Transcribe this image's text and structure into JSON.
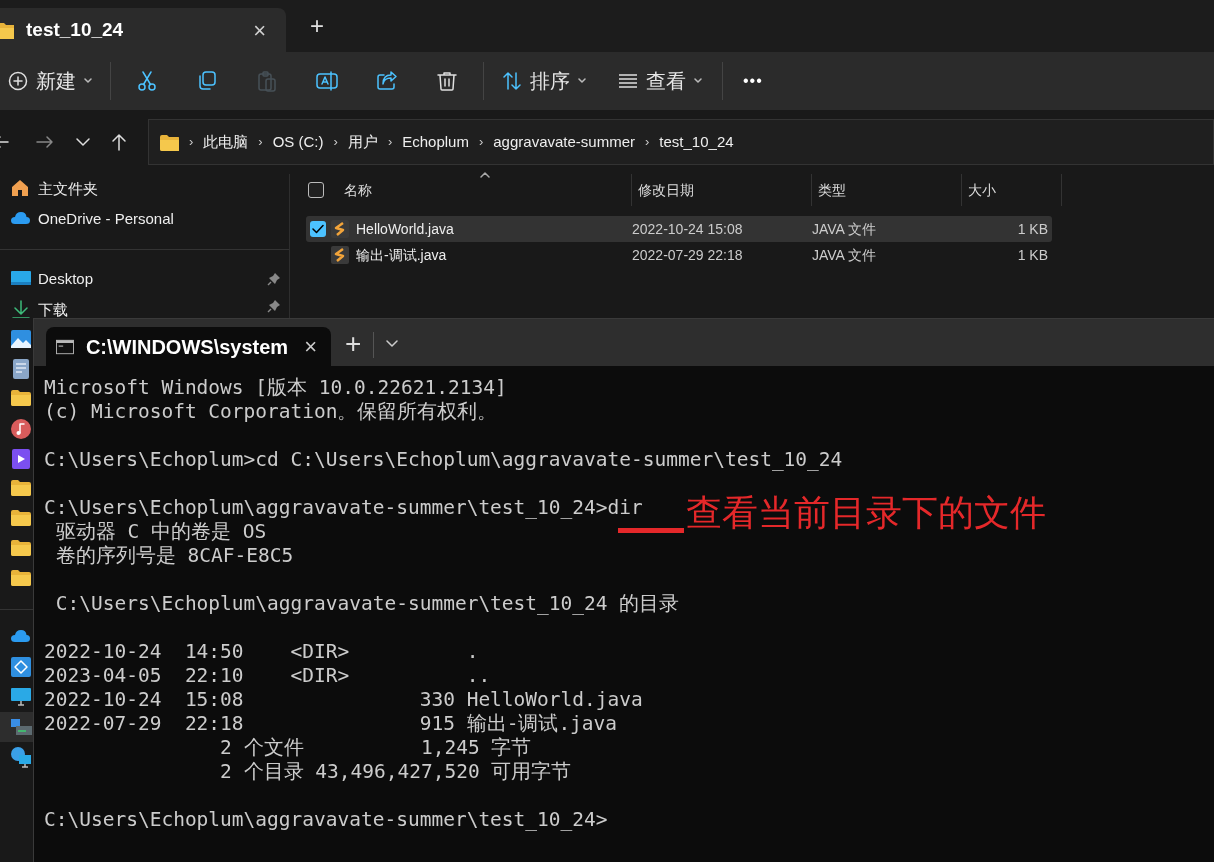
{
  "explorer": {
    "tab": {
      "title": "test_10_24",
      "close": "×",
      "new_tab": "+"
    },
    "toolbar": {
      "new": "新建",
      "actions": [
        {
          "kind": "cut",
          "disabled": false
        },
        {
          "kind": "copy",
          "disabled": false
        },
        {
          "kind": "paste",
          "disabled": true
        },
        {
          "kind": "rename",
          "disabled": false
        },
        {
          "kind": "share",
          "disabled": false
        },
        {
          "kind": "delete",
          "disabled": false
        }
      ],
      "sort": "排序",
      "view": "查看",
      "more": "•••"
    },
    "breadcrumb_separator": "›",
    "breadcrumbs": [
      "此电脑",
      "OS (C:)",
      "用户",
      "Echoplum",
      "aggravavate-summer",
      "test_10_24"
    ],
    "sidebar": {
      "groups": [
        [
          {
            "kind": "home",
            "label": "主文件夹",
            "pinned": false,
            "selected": false
          },
          {
            "kind": "cloud",
            "label": "OneDrive - Personal",
            "pinned": false,
            "selected": false
          }
        ],
        [
          {
            "kind": "desktop",
            "label": "Desktop",
            "pinned": true,
            "selected": false
          },
          {
            "kind": "download",
            "label": "下载",
            "pinned": true,
            "selected": false
          },
          {
            "kind": "picture",
            "selected": false
          },
          {
            "kind": "document",
            "selected": false
          },
          {
            "kind": "folder",
            "selected": false
          },
          {
            "kind": "music",
            "selected": false
          },
          {
            "kind": "video",
            "selected": false
          },
          {
            "kind": "folder",
            "selected": false
          },
          {
            "kind": "folder",
            "selected": false
          },
          {
            "kind": "folder",
            "selected": false
          },
          {
            "kind": "folder",
            "selected": false
          }
        ],
        [
          {
            "kind": "cloud",
            "selected": false
          },
          {
            "kind": "app",
            "selected": false
          },
          {
            "kind": "monitor",
            "selected": false
          },
          {
            "kind": "computer",
            "selected": true
          },
          {
            "kind": "network",
            "selected": false
          }
        ]
      ]
    },
    "table": {
      "all_selected": false,
      "columns": [
        {
          "label": "名称",
          "sorted": true
        },
        {
          "label": "修改日期",
          "sorted": false
        },
        {
          "label": "类型",
          "sorted": false
        },
        {
          "label": "大小",
          "sorted": false
        }
      ],
      "rows": [
        {
          "name": "HelloWorld.java",
          "modified": "2022-10-24 15:08",
          "type": "JAVA 文件",
          "size": "1 KB",
          "selected": true
        },
        {
          "name": "输出-调试.java",
          "modified": "2022-07-29 22:18",
          "type": "JAVA 文件",
          "size": "1 KB",
          "selected": false
        }
      ]
    }
  },
  "terminal": {
    "tab": {
      "title": "C:\\WINDOWS\\system",
      "close": "×",
      "new_tab": "+"
    },
    "blocks": [
      [
        "Microsoft Windows [版本 10.0.22621.2134]",
        "(c) Microsoft Corporation。保留所有权利。"
      ],
      [
        "C:\\Users\\Echoplum>cd C:\\Users\\Echoplum\\aggravavate-summer\\test_10_24"
      ],
      [
        "C:\\Users\\Echoplum\\aggravavate-summer\\test_10_24>dir",
        " 驱动器 C 中的卷是 OS",
        " 卷的序列号是 8CAF-E8C5"
      ],
      [
        " C:\\Users\\Echoplum\\aggravavate-summer\\test_10_24 的目录"
      ],
      [
        "2022-10-24  14:50    <DIR>          .",
        "2023-04-05  22:10    <DIR>          ..",
        "2022-10-24  15:08               330 HelloWorld.java",
        "2022-07-29  22:18               915 输出-调试.java",
        "               2 个文件          1,245 字节",
        "               2 个目录 43,496,427,520 可用字节"
      ],
      [
        "C:\\Users\\Echoplum\\aggravavate-summer\\test_10_24>"
      ]
    ],
    "annotation": "查看当前目录下的文件"
  }
}
